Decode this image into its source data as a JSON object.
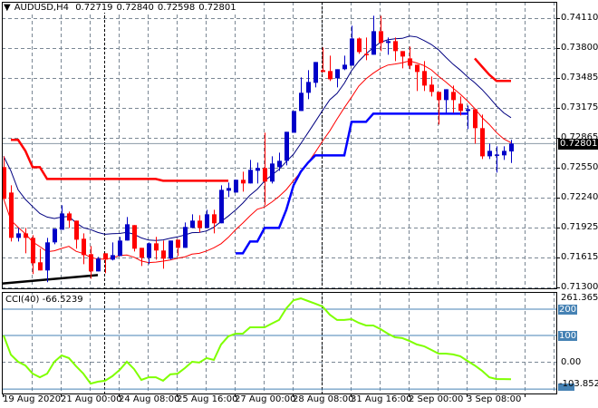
{
  "header": {
    "symbol": "AUDUSD,H4",
    "open": "0.72719",
    "high": "0.72840",
    "low": "0.72598",
    "close": "0.72801",
    "menu_icon": "triangle-down-icon"
  },
  "price_axis": {
    "ticks": [
      "0.74110",
      "0.73800",
      "0.73485",
      "0.73175",
      "0.72865",
      "0.72550",
      "0.72240",
      "0.71925",
      "0.71615",
      "0.71300"
    ],
    "current_price": "0.72801"
  },
  "cci": {
    "title": "CCI(40) -66.5239",
    "axis_max": "261.365",
    "axis_min": "-103.8524",
    "level_200": "200",
    "level_100": "100",
    "level_0": "0.00",
    "values": [
      100,
      27,
      0,
      -14,
      -45,
      -59,
      -45,
      0,
      24,
      14,
      -17,
      -45,
      -83,
      -76,
      -72,
      -55,
      -31,
      0,
      -28,
      -69,
      -59,
      -59,
      -72,
      -48,
      -45,
      -24,
      0,
      -3,
      14,
      7,
      66,
      97,
      107,
      107,
      131,
      131,
      131,
      145,
      159,
      203,
      234,
      241,
      231,
      221,
      210,
      179,
      159,
      159,
      162,
      148,
      138,
      138,
      124,
      107,
      93,
      90,
      79,
      66,
      59,
      45,
      31,
      31,
      28,
      21,
      3,
      -14,
      -34,
      -59,
      -66,
      -66,
      -66.5239
    ],
    "line_color": "#7fff00",
    "level_color": "#4682b4"
  },
  "time_axis": [
    "19 Aug 2020",
    "21 Aug 00:00",
    "24 Aug 08:00",
    "25 Aug 16:00",
    "27 Aug 00:00",
    "28 Aug 08:00",
    "31 Aug 16:00",
    "2 Sep 00:00",
    "3 Sep 08:00"
  ],
  "colors": {
    "bull": "#0000c8",
    "bear": "#ff0000",
    "ma_high": "#000080",
    "ma_low": "#ff0000",
    "step_up": "#0000ff",
    "step_down": "#ff0000",
    "trendline": "#000000"
  },
  "chart_data": {
    "type": "candlestick",
    "ohlc": [
      [
        0.72555,
        0.72668,
        0.72224,
        0.72224
      ],
      [
        0.7229,
        0.72366,
        0.71779,
        0.71817
      ],
      [
        0.71817,
        0.71921,
        0.71779,
        0.71864
      ],
      [
        0.71864,
        0.71921,
        0.71656,
        0.71817
      ],
      [
        0.71817,
        0.71845,
        0.71439,
        0.71552
      ],
      [
        0.71562,
        0.71704,
        0.71477,
        0.71477
      ],
      [
        0.71477,
        0.71817,
        0.71354,
        0.7177
      ],
      [
        0.7177,
        0.71912,
        0.71751,
        0.71912
      ],
      [
        0.71902,
        0.72158,
        0.71902,
        0.72072
      ],
      [
        0.72072,
        0.72091,
        0.71921,
        0.71997
      ],
      [
        0.71997,
        0.71997,
        0.71704,
        0.71798
      ],
      [
        0.71808,
        0.71864,
        0.71543,
        0.71637
      ],
      [
        0.71647,
        0.71732,
        0.71391,
        0.71467
      ],
      [
        0.71467,
        0.71618,
        0.71467,
        0.716
      ],
      [
        0.71656,
        0.71656,
        0.71448,
        0.7159
      ],
      [
        0.7159,
        0.7177,
        0.71581,
        0.71637
      ],
      [
        0.71628,
        0.71827,
        0.71628,
        0.71789
      ],
      [
        0.71789,
        0.72035,
        0.71789,
        0.71959
      ],
      [
        0.7195,
        0.7195,
        0.71675,
        0.71704
      ],
      [
        0.71713,
        0.71713,
        0.71524,
        0.71609
      ],
      [
        0.71609,
        0.7177,
        0.71543,
        0.7176
      ],
      [
        0.7176,
        0.71827,
        0.7159,
        0.71685
      ],
      [
        0.71685,
        0.71789,
        0.71495,
        0.716
      ],
      [
        0.716,
        0.71789,
        0.7159,
        0.71789
      ],
      [
        0.71798,
        0.71798,
        0.71628,
        0.71713
      ],
      [
        0.71713,
        0.71978,
        0.71713,
        0.71931
      ],
      [
        0.71921,
        0.72063,
        0.71921,
        0.71997
      ],
      [
        0.71997,
        0.72053,
        0.71874,
        0.71921
      ],
      [
        0.71921,
        0.7211,
        0.71921,
        0.72063
      ],
      [
        0.72063,
        0.7211,
        0.71864,
        0.71969
      ],
      [
        0.71969,
        0.72366,
        0.71969,
        0.72318
      ],
      [
        0.72309,
        0.72394,
        0.72243,
        0.72337
      ],
      [
        0.7229,
        0.72423,
        0.7229,
        0.72423
      ],
      [
        0.72423,
        0.72508,
        0.72299,
        0.72385
      ],
      [
        0.72385,
        0.72631,
        0.72385,
        0.72527
      ],
      [
        0.72517,
        0.72602,
        0.72385,
        0.72546
      ],
      [
        0.72546,
        0.72914,
        0.72158,
        0.72404
      ],
      [
        0.72404,
        0.72668,
        0.72385,
        0.72593
      ],
      [
        0.72555,
        0.72706,
        0.72517,
        0.72621
      ],
      [
        0.72621,
        0.72924,
        0.72574,
        0.72924
      ],
      [
        0.72914,
        0.73141,
        0.72914,
        0.73141
      ],
      [
        0.73141,
        0.73491,
        0.73141,
        0.73331
      ],
      [
        0.73331,
        0.73567,
        0.73264,
        0.73444
      ],
      [
        0.73435,
        0.73652,
        0.73387,
        0.73652
      ],
      [
        0.73567,
        0.73804,
        0.73548,
        0.73548
      ],
      [
        0.73558,
        0.73718,
        0.73454,
        0.73472
      ],
      [
        0.73482,
        0.73577,
        0.73387,
        0.73577
      ],
      [
        0.73577,
        0.73718,
        0.73567,
        0.73624
      ],
      [
        0.73614,
        0.74031,
        0.73614,
        0.73898
      ],
      [
        0.73898,
        0.73908,
        0.73737,
        0.73756
      ],
      [
        0.73737,
        0.73908,
        0.73671,
        0.73736
      ],
      [
        0.73728,
        0.74135,
        0.73728,
        0.73974
      ],
      [
        0.73974,
        0.74135,
        0.73766,
        0.73851
      ],
      [
        0.73851,
        0.73908,
        0.73728,
        0.7387
      ],
      [
        0.7387,
        0.73908,
        0.73662,
        0.73766
      ],
      [
        0.73766,
        0.73766,
        0.73586,
        0.73709
      ],
      [
        0.7369,
        0.73813,
        0.73577,
        0.73614
      ],
      [
        0.73624,
        0.73624,
        0.7335,
        0.73548
      ],
      [
        0.73558,
        0.73662,
        0.7335,
        0.73406
      ],
      [
        0.73416,
        0.73501,
        0.73293,
        0.7334
      ],
      [
        0.7334,
        0.7334,
        0.73,
        0.73255
      ],
      [
        0.73255,
        0.73368,
        0.73123,
        0.73368
      ],
      [
        0.7334,
        0.73406,
        0.73123,
        0.73255
      ],
      [
        0.73217,
        0.73293,
        0.73094,
        0.73141
      ],
      [
        0.73141,
        0.73198,
        0.72952,
        0.7316
      ],
      [
        0.7316,
        0.7316,
        0.72801,
        0.72962
      ],
      [
        0.72962,
        0.73104,
        0.7264,
        0.72668
      ],
      [
        0.72668,
        0.72801,
        0.7264,
        0.72725
      ],
      [
        0.72678,
        0.72772,
        0.72498,
        0.72687
      ],
      [
        0.72678,
        0.72772,
        0.72631,
        0.72725
      ],
      [
        0.72719,
        0.7284,
        0.72598,
        0.72801
      ]
    ],
    "ma_period": 10,
    "step_down_segments": [
      {
        "start": 1,
        "values": [
          0.72839,
          0.72839,
          0.72725,
          0.72555,
          0.72555,
          0.72432,
          0.72432,
          0.72432,
          0.72432,
          0.72432,
          0.72432,
          0.72432,
          0.72432,
          0.72432,
          0.72432,
          0.72432,
          0.72432,
          0.72432,
          0.72432,
          0.72432,
          0.72432,
          0.72413,
          0.72413,
          0.72413,
          0.72413,
          0.72413,
          0.72413,
          0.72413,
          0.72413,
          0.72413,
          0.72413
        ]
      },
      {
        "start": 65,
        "values": [
          0.7369,
          0.73604,
          0.7352,
          0.73454,
          0.73454,
          0.73454
        ]
      }
    ],
    "step_up_segments": [
      {
        "start": 32,
        "values": [
          0.71656,
          0.71656,
          0.71779,
          0.71779,
          0.71921,
          0.71921,
          0.71921,
          0.7211,
          0.72366,
          0.72508,
          0.72602,
          0.72678,
          0.72678,
          0.72678,
          0.72678,
          0.72678,
          0.73028,
          0.73028,
          0.73028,
          0.73113,
          0.73113,
          0.73113,
          0.73113,
          0.73113,
          0.73113,
          0.73113,
          0.73113,
          0.73113,
          0.73113,
          0.73113,
          0.73113,
          0.73113,
          0.73113
        ]
      }
    ],
    "trendline": {
      "from": [
        0,
        0.7134
      ],
      "to": [
        13,
        0.71429
      ]
    },
    "ylim": [
      0.713,
      0.7411
    ],
    "cci_ylim": [
      -103.8524,
      261.365
    ]
  }
}
